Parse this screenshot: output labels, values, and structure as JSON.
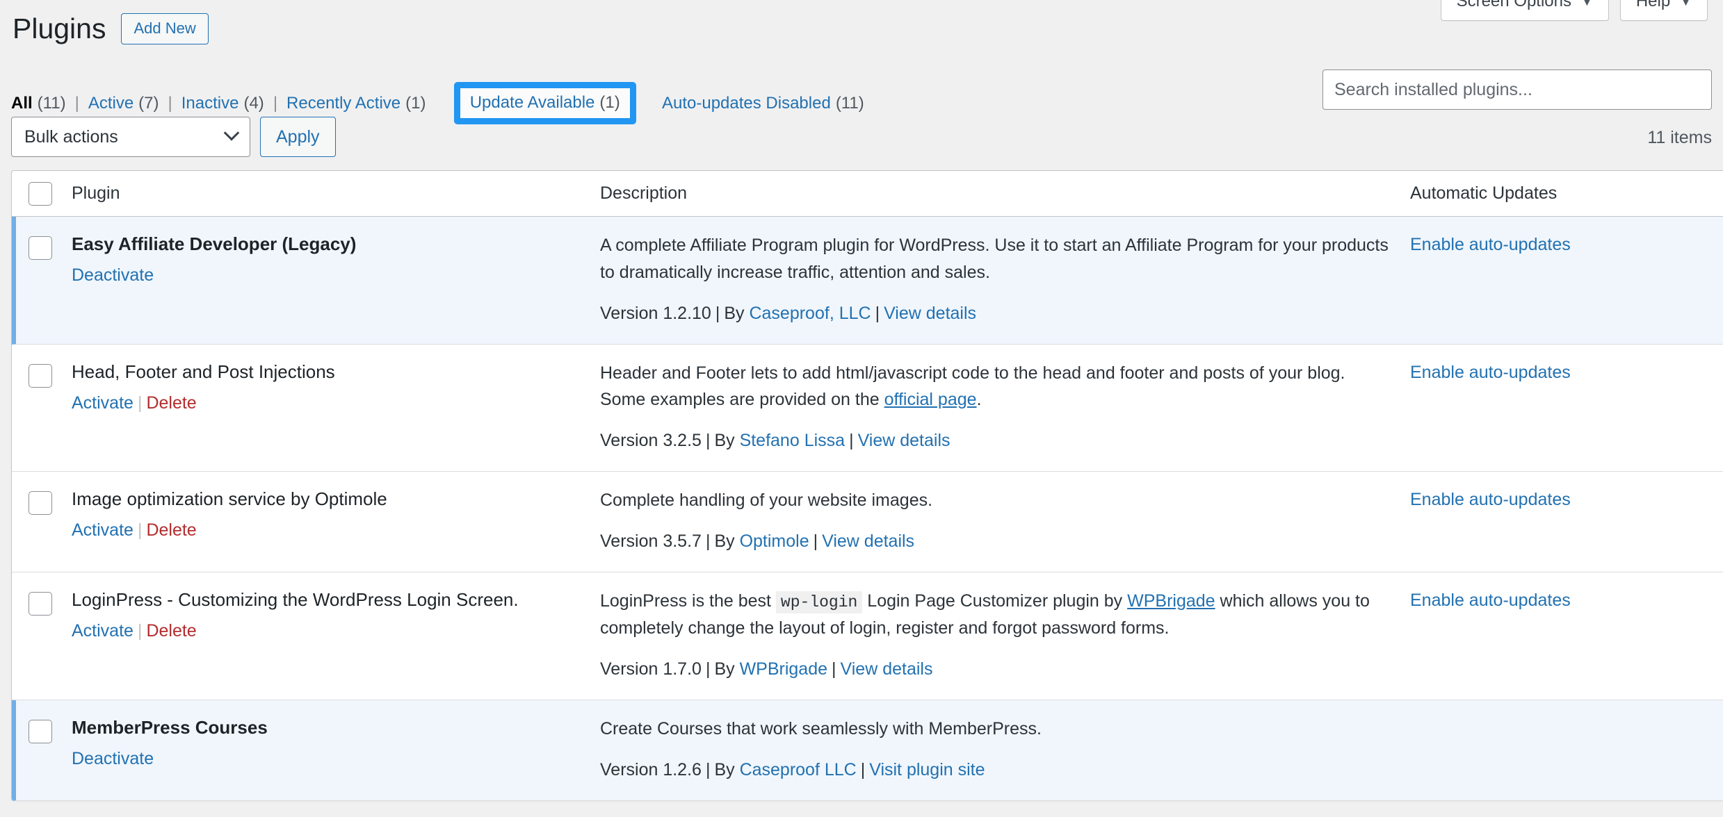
{
  "screen_meta": {
    "screen_options_label": "Screen Options",
    "help_label": "Help",
    "caret": "▼"
  },
  "header": {
    "title": "Plugins",
    "add_new_label": "Add New"
  },
  "filters": [
    {
      "label": "All",
      "count": "(11)",
      "current": true
    },
    {
      "label": "Active",
      "count": "(7)",
      "current": false
    },
    {
      "label": "Inactive",
      "count": "(4)",
      "current": false
    },
    {
      "label": "Recently Active",
      "count": "(1)",
      "current": false
    },
    {
      "label": "Update Available",
      "count": "(1)",
      "current": false,
      "focused": true
    },
    {
      "label": "Auto-updates Disabled",
      "count": "(11)",
      "current": false
    }
  ],
  "tablenav": {
    "bulk_actions_label": "Bulk actions",
    "apply_label": "Apply",
    "items_count": "11 items"
  },
  "search": {
    "placeholder": "Search installed plugins...",
    "value": ""
  },
  "table": {
    "columns": {
      "plugin": "Plugin",
      "description": "Description",
      "automatic_updates": "Automatic Updates"
    },
    "rows": [
      {
        "name": "Easy Affiliate Developer (Legacy)",
        "active": true,
        "actions": [
          {
            "label": "Deactivate",
            "kind": "link"
          }
        ],
        "description": "A complete Affiliate Program plugin for WordPress. Use it to start an Affiliate Program for your products to dramatically increase traffic, attention and sales.",
        "version": "Version 1.2.10",
        "by_label": "By",
        "author": "Caseproof, LLC",
        "details_label": "View details",
        "auto_update_label": "Enable auto-updates"
      },
      {
        "name": "Head, Footer and Post Injections",
        "active": false,
        "actions": [
          {
            "label": "Activate",
            "kind": "link"
          },
          {
            "label": "Delete",
            "kind": "delete"
          }
        ],
        "description_pre": "Header and Footer lets to add html/javascript code to the head and footer and posts of your blog. Some examples are provided on the ",
        "description_link": "official page",
        "description_post": ".",
        "version": "Version 3.2.5",
        "by_label": "By",
        "author": "Stefano Lissa",
        "details_label": "View details",
        "auto_update_label": "Enable auto-updates"
      },
      {
        "name": "Image optimization service by Optimole",
        "active": false,
        "actions": [
          {
            "label": "Activate",
            "kind": "link"
          },
          {
            "label": "Delete",
            "kind": "delete"
          }
        ],
        "description": "Complete handling of your website images.",
        "version": "Version 3.5.7",
        "by_label": "By",
        "author": "Optimole",
        "details_label": "View details",
        "auto_update_label": "Enable auto-updates"
      },
      {
        "name": "LoginPress - Customizing the WordPress Login Screen.",
        "active": false,
        "actions": [
          {
            "label": "Activate",
            "kind": "link"
          },
          {
            "label": "Delete",
            "kind": "delete"
          }
        ],
        "description_pre": "LoginPress is the best ",
        "description_code": "wp-login",
        "description_mid": " Login Page Customizer plugin by ",
        "description_link": "WPBrigade",
        "description_post": " which allows you to completely change the layout of login, register and forgot password forms.",
        "version": "Version 1.7.0",
        "by_label": "By",
        "author": "WPBrigade",
        "details_label": "View details",
        "auto_update_label": "Enable auto-updates"
      },
      {
        "name": "MemberPress Courses",
        "active": true,
        "actions": [
          {
            "label": "Deactivate",
            "kind": "link"
          }
        ],
        "description": "Create Courses that work seamlessly with MemberPress.",
        "version": "Version 1.2.6",
        "by_label": "By",
        "author": "Caseproof LLC",
        "details_label": "Visit plugin site",
        "auto_update_label": ""
      }
    ]
  },
  "colors": {
    "link": "#2271b1",
    "delete": "#b32d2e",
    "focus_ring": "#2196f3",
    "active_row_bg": "#f0f6fc",
    "active_row_border": "#72aee6",
    "page_bg": "#f0f0f1"
  }
}
